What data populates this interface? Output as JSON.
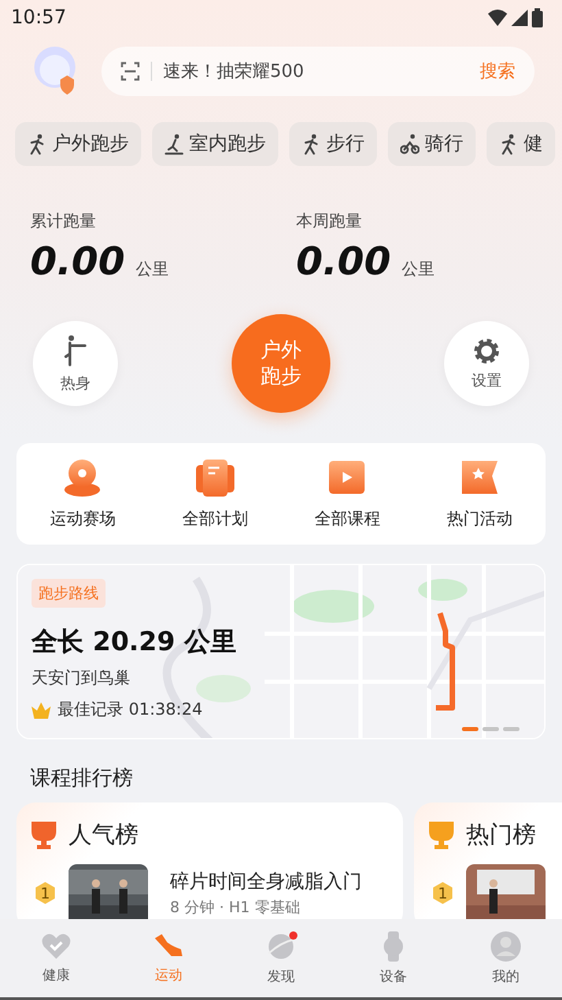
{
  "status_bar": {
    "time": "10:57"
  },
  "search": {
    "placeholder": "速来！抽荣耀500",
    "button": "搜索"
  },
  "sport_chips": [
    {
      "label": "户外跑步",
      "selected": false
    },
    {
      "label": "室内跑步",
      "selected": false
    },
    {
      "label": "步行",
      "selected": false
    },
    {
      "label": "骑行",
      "selected": false
    },
    {
      "label": "健",
      "selected": false
    }
  ],
  "stats": [
    {
      "label": "累计跑量",
      "value": "0.00",
      "unit": "公里"
    },
    {
      "label": "本周跑量",
      "value": "0.00",
      "unit": "公里"
    }
  ],
  "actions": {
    "warmup": "热身",
    "start": "户外跑步",
    "settings": "设置"
  },
  "shortcuts": [
    {
      "label": "运动赛场",
      "kind": "venue"
    },
    {
      "label": "全部计划",
      "kind": "plan"
    },
    {
      "label": "全部课程",
      "kind": "course"
    },
    {
      "label": "热门活动",
      "kind": "event"
    }
  ],
  "route_card": {
    "tag": "跑步路线",
    "title": "全长 20.29 公里",
    "subtitle": "天安门到鸟巢",
    "record": "最佳记录 01:38:24",
    "pages": [
      {
        "selected": true
      },
      {
        "selected": false
      },
      {
        "selected": false
      }
    ]
  },
  "ranking": {
    "title": "课程排行榜",
    "boards": [
      {
        "title": "人气榜",
        "color": "#f0642c",
        "items": [
          {
            "rank": "1",
            "title": "碎片时间全身减脂入门",
            "meta": "8 分钟 · H1 零基础"
          }
        ]
      },
      {
        "title": "热门榜",
        "color": "#f5a01e",
        "items": [
          {
            "rank": "1"
          }
        ]
      }
    ]
  },
  "bottom_nav": [
    {
      "label": "健康",
      "kind": "health",
      "selected": false,
      "badge": false
    },
    {
      "label": "运动",
      "kind": "sport",
      "selected": true,
      "badge": false
    },
    {
      "label": "发现",
      "kind": "discover",
      "selected": false,
      "badge": true
    },
    {
      "label": "设备",
      "kind": "device",
      "selected": false,
      "badge": false
    },
    {
      "label": "我的",
      "kind": "me",
      "selected": false,
      "badge": false
    }
  ]
}
